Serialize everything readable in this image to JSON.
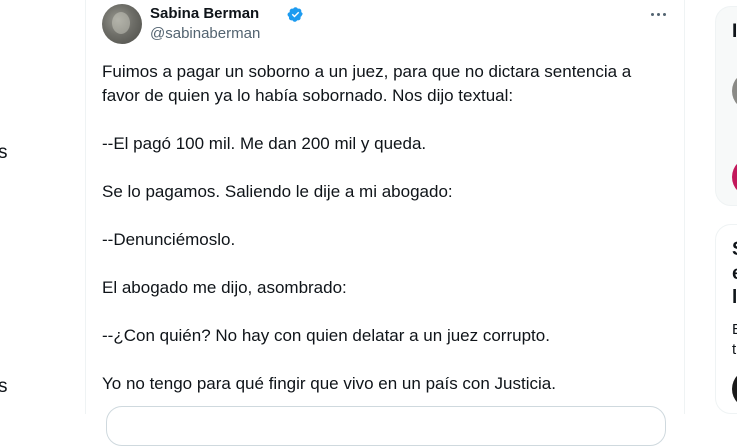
{
  "left_nav": {
    "fragment_1": "s",
    "fragment_2": "s"
  },
  "tweet": {
    "author_name": "Sabina Berman",
    "author_handle": "@sabinaberman",
    "paragraphs": [
      "Fuimos a pagar un soborno a un juez, para que no dictara sentencia a favor de quien ya lo había sobornado. Nos dijo textual:",
      "--El pagó 100 mil. Me dan 200 mil y queda.",
      "Se lo pagamos. Saliendo le dije a mi abogado:",
      "--Denunciémoslo.",
      "El abogado me dijo, asombrado:",
      "--¿Con quién? No hay con quien delatar a un juez corrupto.",
      "Yo no tengo para qué fingir que vivo en un país con Justicia."
    ]
  },
  "right_sidebar": {
    "card1_title_fragment": "I",
    "card2_line1": "S",
    "card2_line2": "e",
    "card2_line3": "l",
    "card2_line4": "E",
    "card2_line5": "t"
  },
  "colors": {
    "verified": "#1d9bf0",
    "text": "#0f1419",
    "secondary_text": "#536471",
    "border": "#eff3f4",
    "accent_avatar": "#c2185b"
  }
}
